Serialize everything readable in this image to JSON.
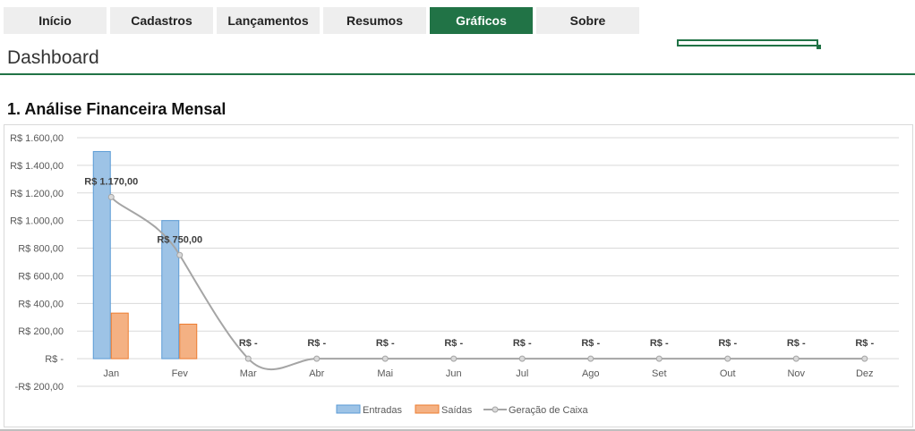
{
  "nav": {
    "tabs": [
      {
        "label": "Início",
        "active": false
      },
      {
        "label": "Cadastros",
        "active": false
      },
      {
        "label": "Lançamentos",
        "active": false
      },
      {
        "label": "Resumos",
        "active": false
      },
      {
        "label": "Gráficos",
        "active": true
      },
      {
        "label": "Sobre",
        "active": false
      }
    ]
  },
  "page": {
    "title": "Dashboard",
    "section_title": "1. Análise Financeira Mensal"
  },
  "colors": {
    "accent": "#217346",
    "entradas_fill": "#9dc3e6",
    "entradas_stroke": "#5b9bd5",
    "saidas_fill": "#f4b183",
    "saidas_stroke": "#ed7d31",
    "geracao_line": "#a5a5a5"
  },
  "chart_data": {
    "type": "bar",
    "categories": [
      "Jan",
      "Fev",
      "Mar",
      "Abr",
      "Mai",
      "Jun",
      "Jul",
      "Ago",
      "Set",
      "Out",
      "Nov",
      "Dez"
    ],
    "series": [
      {
        "name": "Entradas",
        "type": "bar",
        "values": [
          1500,
          1000,
          0,
          0,
          0,
          0,
          0,
          0,
          0,
          0,
          0,
          0
        ]
      },
      {
        "name": "Saídas",
        "type": "bar",
        "values": [
          330,
          250,
          0,
          0,
          0,
          0,
          0,
          0,
          0,
          0,
          0,
          0
        ]
      },
      {
        "name": "Geração de Caixa",
        "type": "line",
        "values": [
          1170,
          750,
          0,
          0,
          0,
          0,
          0,
          0,
          0,
          0,
          0,
          0
        ]
      }
    ],
    "data_labels": [
      "R$ 1.170,00",
      "R$ 750,00",
      "R$ -",
      "R$ -",
      "R$ -",
      "R$ -",
      "R$ -",
      "R$ -",
      "R$ -",
      "R$ -",
      "R$ -",
      "R$ -"
    ],
    "y_ticks": [
      {
        "value": 1600,
        "label": "R$ 1.600,00"
      },
      {
        "value": 1400,
        "label": "R$ 1.400,00"
      },
      {
        "value": 1200,
        "label": "R$ 1.200,00"
      },
      {
        "value": 1000,
        "label": "R$ 1.000,00"
      },
      {
        "value": 800,
        "label": "R$ 800,00"
      },
      {
        "value": 600,
        "label": "R$ 600,00"
      },
      {
        "value": 400,
        "label": "R$ 400,00"
      },
      {
        "value": 200,
        "label": "R$ 200,00"
      },
      {
        "value": 0,
        "label": "R$ -"
      },
      {
        "value": -200,
        "label": "-R$ 200,00"
      }
    ],
    "ylim": [
      -200,
      1600
    ],
    "grid": true,
    "legend_position": "bottom"
  }
}
